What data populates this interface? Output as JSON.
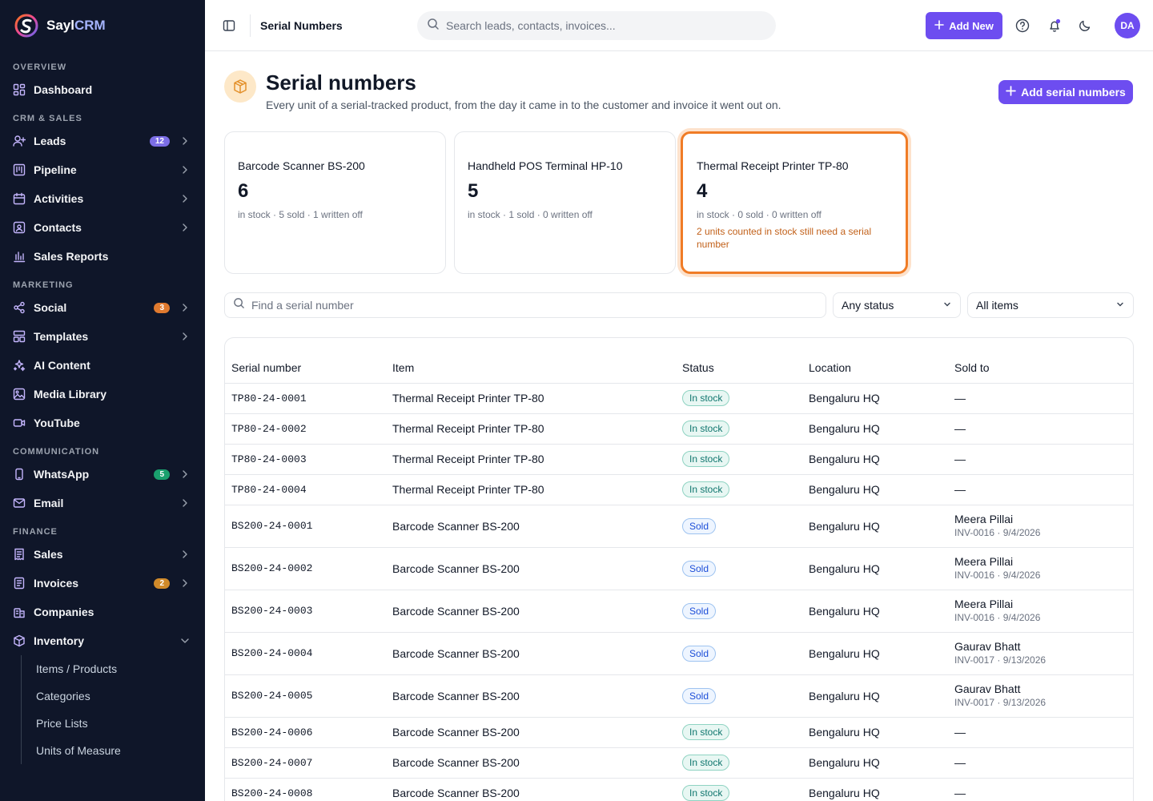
{
  "brand": {
    "name": "Sayl",
    "name_accent": "CRM"
  },
  "sidebar": {
    "sections": [
      {
        "label": "OVERVIEW",
        "items": [
          {
            "label": "Dashboard",
            "icon": "dashboard-icon"
          }
        ]
      },
      {
        "label": "CRM & SALES",
        "items": [
          {
            "label": "Leads",
            "icon": "user-plus-icon",
            "badge": "12",
            "badge_color": "#7c6ee6",
            "chevron": true
          },
          {
            "label": "Pipeline",
            "icon": "kanban-icon",
            "chevron": true
          },
          {
            "label": "Activities",
            "icon": "calendar-icon",
            "chevron": true
          },
          {
            "label": "Contacts",
            "icon": "contact-card-icon",
            "chevron": true
          },
          {
            "label": "Sales Reports",
            "icon": "bar-chart-icon"
          }
        ]
      },
      {
        "label": "MARKETING",
        "items": [
          {
            "label": "Social",
            "icon": "share-icon",
            "badge": "3",
            "badge_color": "#e07a2f",
            "chevron": true
          },
          {
            "label": "Templates",
            "icon": "template-icon",
            "chevron": true
          },
          {
            "label": "AI Content",
            "icon": "sparkles-icon"
          },
          {
            "label": "Media Library",
            "icon": "image-icon"
          },
          {
            "label": "YouTube",
            "icon": "video-icon"
          }
        ]
      },
      {
        "label": "COMMUNICATION",
        "items": [
          {
            "label": "WhatsApp",
            "icon": "phone-icon",
            "badge": "5",
            "badge_color": "#1aa06e",
            "chevron": true
          },
          {
            "label": "Email",
            "icon": "mail-icon",
            "chevron": true
          }
        ]
      },
      {
        "label": "FINANCE",
        "items": [
          {
            "label": "Sales",
            "icon": "receipt-icon",
            "chevron": true
          },
          {
            "label": "Invoices",
            "icon": "invoice-icon",
            "badge": "2",
            "badge_color": "#d08a2a",
            "chevron": true
          },
          {
            "label": "Companies",
            "icon": "building-icon"
          },
          {
            "label": "Inventory",
            "icon": "box-icon",
            "chevron": true,
            "expanded": true
          }
        ]
      }
    ],
    "inventory_sub": [
      "Items / Products",
      "Categories",
      "Price Lists",
      "Units of Measure"
    ]
  },
  "header": {
    "breadcrumb": "Serial Numbers",
    "search_placeholder": "Search leads, contacts, invoices...",
    "add_new": "Add New",
    "avatar": "DA"
  },
  "page": {
    "title": "Serial numbers",
    "subtitle": "Every unit of a serial-tracked product, from the day it came in to the customer and invoice it went out on.",
    "add_button": "Add serial numbers"
  },
  "cards": [
    {
      "name": "Barcode Scanner BS-200",
      "in_stock": "6",
      "meta": "in stock · 5 sold · 1 written off",
      "warning": ""
    },
    {
      "name": "Handheld POS Terminal HP-10",
      "in_stock": "5",
      "meta": "in stock · 1 sold · 0 written off",
      "warning": ""
    },
    {
      "name": "Thermal Receipt Printer TP-80",
      "in_stock": "4",
      "meta": "in stock · 0 sold · 0 written off",
      "warning": "2 units counted in stock still need a serial number"
    }
  ],
  "filters": {
    "search_placeholder": "Find a serial number",
    "status": "Any status",
    "items": "All items"
  },
  "table": {
    "columns": [
      "Serial number",
      "Item",
      "Status",
      "Location",
      "Sold to"
    ],
    "rows": [
      {
        "serial": "TP80-24-0001",
        "item": "Thermal Receipt Printer TP-80",
        "status": "In stock",
        "location": "Bengaluru HQ",
        "sold_to": "—",
        "invoice": ""
      },
      {
        "serial": "TP80-24-0002",
        "item": "Thermal Receipt Printer TP-80",
        "status": "In stock",
        "location": "Bengaluru HQ",
        "sold_to": "—",
        "invoice": ""
      },
      {
        "serial": "TP80-24-0003",
        "item": "Thermal Receipt Printer TP-80",
        "status": "In stock",
        "location": "Bengaluru HQ",
        "sold_to": "—",
        "invoice": ""
      },
      {
        "serial": "TP80-24-0004",
        "item": "Thermal Receipt Printer TP-80",
        "status": "In stock",
        "location": "Bengaluru HQ",
        "sold_to": "—",
        "invoice": ""
      },
      {
        "serial": "BS200-24-0001",
        "item": "Barcode Scanner BS-200",
        "status": "Sold",
        "location": "Bengaluru HQ",
        "sold_to": "Meera Pillai",
        "invoice": "INV-0016 · 9/4/2026"
      },
      {
        "serial": "BS200-24-0002",
        "item": "Barcode Scanner BS-200",
        "status": "Sold",
        "location": "Bengaluru HQ",
        "sold_to": "Meera Pillai",
        "invoice": "INV-0016 · 9/4/2026"
      },
      {
        "serial": "BS200-24-0003",
        "item": "Barcode Scanner BS-200",
        "status": "Sold",
        "location": "Bengaluru HQ",
        "sold_to": "Meera Pillai",
        "invoice": "INV-0016 · 9/4/2026"
      },
      {
        "serial": "BS200-24-0004",
        "item": "Barcode Scanner BS-200",
        "status": "Sold",
        "location": "Bengaluru HQ",
        "sold_to": "Gaurav Bhatt",
        "invoice": "INV-0017 · 9/13/2026"
      },
      {
        "serial": "BS200-24-0005",
        "item": "Barcode Scanner BS-200",
        "status": "Sold",
        "location": "Bengaluru HQ",
        "sold_to": "Gaurav Bhatt",
        "invoice": "INV-0017 · 9/13/2026"
      },
      {
        "serial": "BS200-24-0006",
        "item": "Barcode Scanner BS-200",
        "status": "In stock",
        "location": "Bengaluru HQ",
        "sold_to": "—",
        "invoice": ""
      },
      {
        "serial": "BS200-24-0007",
        "item": "Barcode Scanner BS-200",
        "status": "In stock",
        "location": "Bengaluru HQ",
        "sold_to": "—",
        "invoice": ""
      },
      {
        "serial": "BS200-24-0008",
        "item": "Barcode Scanner BS-200",
        "status": "In stock",
        "location": "Bengaluru HQ",
        "sold_to": "—",
        "invoice": ""
      }
    ]
  },
  "colors": {
    "accent": "#6d4df0",
    "sidebar_bg": "#0f1629",
    "highlight": "#f07c26"
  }
}
